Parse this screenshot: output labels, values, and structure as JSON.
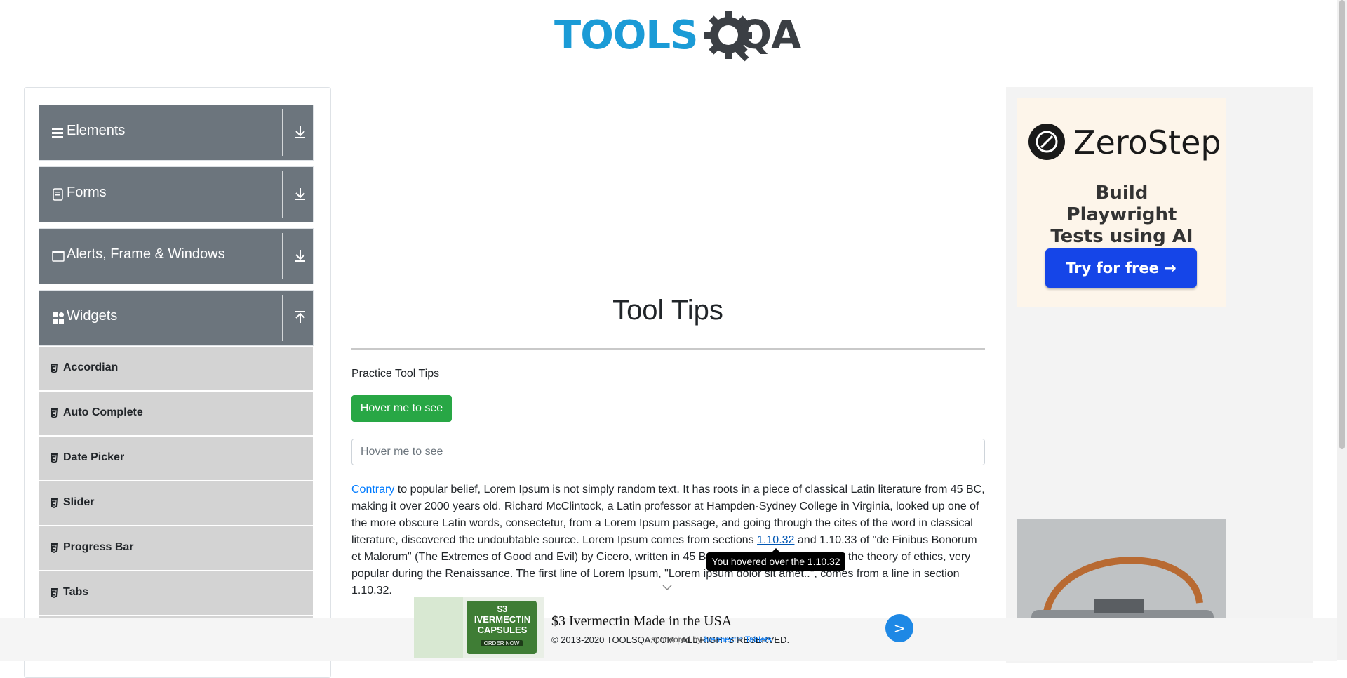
{
  "logo": {
    "text_main": "TOOLS",
    "text_accent": "QA"
  },
  "sidebar": {
    "groups": [
      {
        "label": "Elements",
        "icon": "hamburger-icon",
        "expanded": false
      },
      {
        "label": "Forms",
        "icon": "clipboard-icon",
        "expanded": false
      },
      {
        "label": "Alerts, Frame & Windows",
        "icon": "window-icon",
        "expanded": false
      },
      {
        "label": "Widgets",
        "icon": "widgets-icon",
        "expanded": true
      }
    ],
    "items": [
      {
        "label": "Accordian"
      },
      {
        "label": "Auto Complete"
      },
      {
        "label": "Date Picker"
      },
      {
        "label": "Slider"
      },
      {
        "label": "Progress Bar"
      },
      {
        "label": "Tabs"
      }
    ]
  },
  "main": {
    "title": "Tool Tips",
    "practice_label": "Practice Tool Tips",
    "hover_button": "Hover me to see",
    "hover_field_placeholder": "Hover me to see",
    "paragraph": {
      "link1": "Contrary",
      "text1": " to popular belief, Lorem Ipsum is not simply random text. It has roots in a piece of classical Latin literature from 45 BC, making it over 2000 years old. Richard McClintock, a Latin professor at Hampden-Sydney College in Virginia, looked up one of the more obscure Latin words, consectetur, from a Lorem Ipsum passage, and going through the cites of the word in classical literature, discovered the undoubtable source. Lorem Ipsum comes from sections ",
      "link2": "1.10.32",
      "text2": " and 1.10.33 of \"de Finibus Bonorum et Malorum\" (The Extremes of Good and Evil) by Cicero, written in 45 BC. This book is a treatise on the theory of ethics, very popular during the Renaissance. The first line of Lorem Ipsum, \"Lorem ipsum dolor sit amet..\", comes from a line in section 1.10.32."
    },
    "tooltip": "You hovered over the 1.10.32"
  },
  "right_ad": {
    "brand": "ZeroStep",
    "tagline": "Build Playwright Tests using AI",
    "cta": "Try for free →"
  },
  "footer": {
    "copyright": "© 2013-2020 TOOLSQA.COM | ALL RIGHTS RESERVED.",
    "sponsor_prefix": "sponsored by ",
    "sponsor_link": "Ivermectin Tablets"
  },
  "bottom_ad": {
    "headline": "$3 Ivermectin Made in the USA",
    "image_text": "$3 IVERMECTIN CAPSULES",
    "image_sub": "ORDER NOW",
    "go": ">"
  },
  "colors": {
    "sidebar_group": "#6c757d",
    "sidebar_item": "#d3d3d3",
    "button_green": "#28a745",
    "link": "#007bff",
    "logo_blue": "#1b9bd6"
  }
}
